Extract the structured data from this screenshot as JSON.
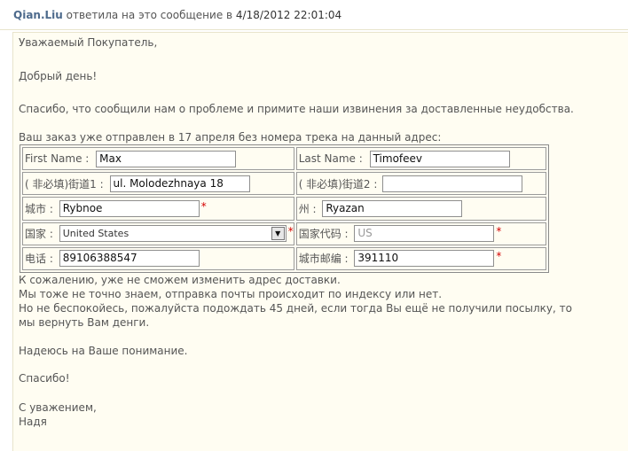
{
  "header": {
    "author": "Qian.Liu",
    "action": " ответила на это сообщение в ",
    "date": "4/18/2012 22:01:04"
  },
  "message": {
    "greeting": "Уважаемый Покупатель,",
    "hello": "Добрый день!",
    "thanks_line": "Спасибо, что сообщили нам о проблеме и примите наши извинения за доставленные неудобства.",
    "order_line": "Ваш заказ уже отправлен в 17 апреля без номера трека на данный адрес:",
    "after": [
      "К сожалению, уже не сможем изменить адрес доставки.",
      "Мы тоже не точно знаем, отправка почты происходит по индексу или нет.",
      "Но не беспокойесь, пожалуйста подождать 45 дней, если тогда Вы ещё не получили посылку, то",
      "мы вернуть Вам денги.",
      "Надеюсь на Ваше понимание.",
      "Спасибо!",
      "С уважением,",
      "Надя"
    ]
  },
  "form": {
    "first_name": {
      "label": "First Name :",
      "value": "Max"
    },
    "last_name": {
      "label": "Last Name :",
      "value": "Timofeev"
    },
    "street1": {
      "label": "( 非必填)街道1 :",
      "value": "ul. Molodezhnaya 18"
    },
    "street2": {
      "label": "( 非必填)街道2 :",
      "value": ""
    },
    "city": {
      "label": "城市 :",
      "value": "Rybnoe"
    },
    "state": {
      "label": "州 :",
      "value": "Ryazan"
    },
    "country": {
      "label": "国家 :",
      "value": "United States"
    },
    "country_code": {
      "label": "国家代码 :",
      "value": "US"
    },
    "phone": {
      "label": "电话 :",
      "value": "89106388547"
    },
    "zip": {
      "label": "城市邮编 :",
      "value": "391110"
    },
    "required_mark": "*"
  }
}
